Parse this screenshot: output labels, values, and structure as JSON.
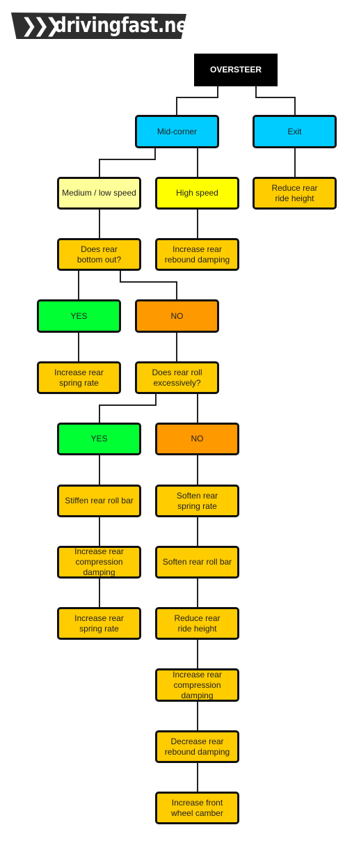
{
  "logo": {
    "chevrons": "❯❯❯",
    "text": "drivingfast.net"
  },
  "colors": {
    "root": "#000000",
    "phase": "#00ccff",
    "medium_low": "#ffff99",
    "high": "#ffff00",
    "action": "#ffcc00",
    "yes": "#00ff33",
    "no": "#ff9900"
  },
  "nodes": {
    "oversteer": "OVERSTEER",
    "mid_corner": "Mid-corner",
    "exit": "Exit",
    "medium_low_speed": "Medium / low speed",
    "high_speed": "High speed",
    "exit_reduce_ride_height": "Reduce rear\nride height",
    "q_bottom_out": "Does rear\nbottom out?",
    "increase_rebound": "Increase rear\nrebound damping",
    "yes1": "YES",
    "no1": "NO",
    "increase_spring_rate1": "Increase rear\nspring rate",
    "q_roll": "Does rear roll\nexcessively?",
    "yes2": "YES",
    "no2": "NO",
    "stiffen_roll_bar": "Stiffen rear roll bar",
    "increase_compression1": "Increase rear\ncompression damping",
    "increase_spring_rate2": "Increase rear\nspring rate",
    "soften_spring_rate": "Soften rear\nspring rate",
    "soften_roll_bar": "Soften rear roll bar",
    "reduce_ride_height2": "Reduce rear\nride height",
    "increase_compression2": "Increase rear\ncompression\ndamping",
    "decrease_rebound": "Decrease rear\nrebound damping",
    "increase_camber": "Increase front\nwheel camber"
  }
}
